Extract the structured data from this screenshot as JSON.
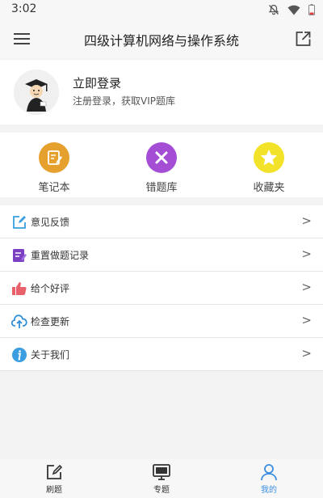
{
  "status": {
    "time": "3:02"
  },
  "appbar": {
    "title": "四级计算机网络与操作系统"
  },
  "profile": {
    "title": "立即登录",
    "subtitle": "注册登录，获取VIP题库"
  },
  "quick": [
    {
      "label": "笔记本",
      "color": "#e6a02e"
    },
    {
      "label": "错题库",
      "color": "#a44ed6"
    },
    {
      "label": "收藏夹",
      "color": "#f2e22a"
    }
  ],
  "list": [
    {
      "label": "意见反馈",
      "arrow": ">",
      "icon": "edit-icon"
    },
    {
      "label": "重置做题记录",
      "arrow": ">",
      "icon": "notepad-icon"
    },
    {
      "label": "给个好评",
      "arrow": ">",
      "icon": "thumbs-up-icon"
    },
    {
      "label": "检查更新",
      "arrow": ">",
      "icon": "cloud-upload-icon"
    },
    {
      "label": "关于我们",
      "arrow": ">",
      "icon": "info-icon"
    }
  ],
  "tabs": [
    {
      "label": "刷题"
    },
    {
      "label": "专题"
    },
    {
      "label": "我的",
      "active": true
    }
  ],
  "colors": {
    "accent": "#3a8de0"
  }
}
